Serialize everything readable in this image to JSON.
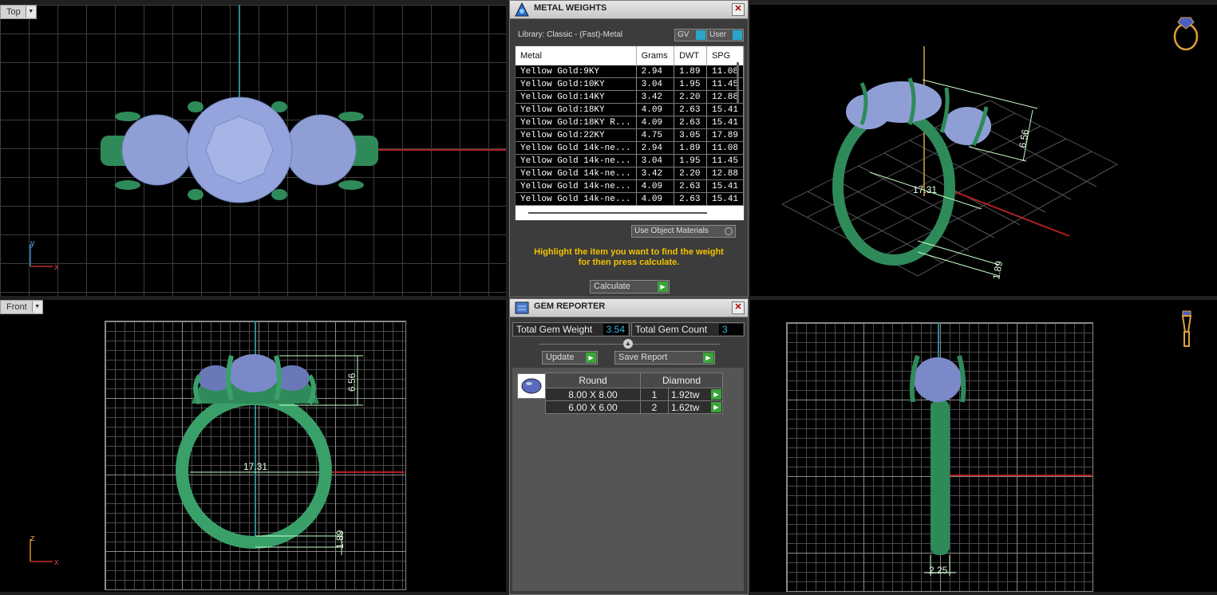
{
  "viewports": {
    "top": {
      "label": "Top",
      "axis_v": "y",
      "axis_h": "x"
    },
    "front": {
      "label": "Front",
      "axis_v": "z",
      "axis_h": "x",
      "width_dim": "17.31",
      "height_dim": "6.56",
      "shank_dim": "1.89"
    },
    "perspective": {
      "width_dim": "17.31",
      "height_dim": "6.56",
      "shank_dim": "1.89"
    },
    "side": {
      "shank_dim": "2.25"
    }
  },
  "metal_weights": {
    "title": "METAL WEIGHTS",
    "library": "Library: Classic - (Fast)-Metal",
    "toggle_gv": "GV",
    "toggle_user": "User",
    "columns": [
      "Metal",
      "Grams",
      "DWT",
      "SPG"
    ],
    "rows": [
      [
        "Yellow Gold:9KY",
        "2.94",
        "1.89",
        "11.08"
      ],
      [
        "Yellow Gold:10KY",
        "3.04",
        "1.95",
        "11.45"
      ],
      [
        "Yellow Gold:14KY",
        "3.42",
        "2.20",
        "12.88"
      ],
      [
        "Yellow Gold:18KY",
        "4.09",
        "2.63",
        "15.41"
      ],
      [
        "Yellow Gold:18KY R...",
        "4.09",
        "2.63",
        "15.41"
      ],
      [
        "Yellow Gold:22KY",
        "4.75",
        "3.05",
        "17.89"
      ],
      [
        "Yellow Gold 14k-ne...",
        "2.94",
        "1.89",
        "11.08"
      ],
      [
        "Yellow Gold 14k-ne...",
        "3.04",
        "1.95",
        "11.45"
      ],
      [
        "Yellow Gold 14k-ne...",
        "3.42",
        "2.20",
        "12.88"
      ],
      [
        "Yellow Gold 14k-ne...",
        "4.09",
        "2.63",
        "15.41"
      ],
      [
        "Yellow Gold 14k-ne...",
        "4.09",
        "2.63",
        "15.41"
      ]
    ],
    "use_object_materials": "Use Object Materials",
    "hint_line1": "Highlight the item you want to find the weight",
    "hint_line2": "for then press calculate.",
    "calculate": "Calculate"
  },
  "gem_reporter": {
    "title": "GEM REPORTER",
    "total_weight_label": "Total Gem Weight",
    "total_weight_value": "3.54",
    "total_count_label": "Total Gem Count",
    "total_count_value": "3",
    "update": "Update",
    "save_report": "Save Report",
    "shape_header": "Round",
    "type_header": "Diamond",
    "rows": [
      {
        "size": "8.00 X 8.00",
        "qty": "1",
        "tw": "1.92tw"
      },
      {
        "size": "6.00 X 6.00",
        "qty": "2",
        "tw": "1.62tw"
      }
    ]
  },
  "colors": {
    "ring": "#2f8a5a",
    "gem": "#8f9fd6",
    "background": "#000000",
    "highlight_text": "#f2c200",
    "dimension": "#c8ffc8"
  }
}
